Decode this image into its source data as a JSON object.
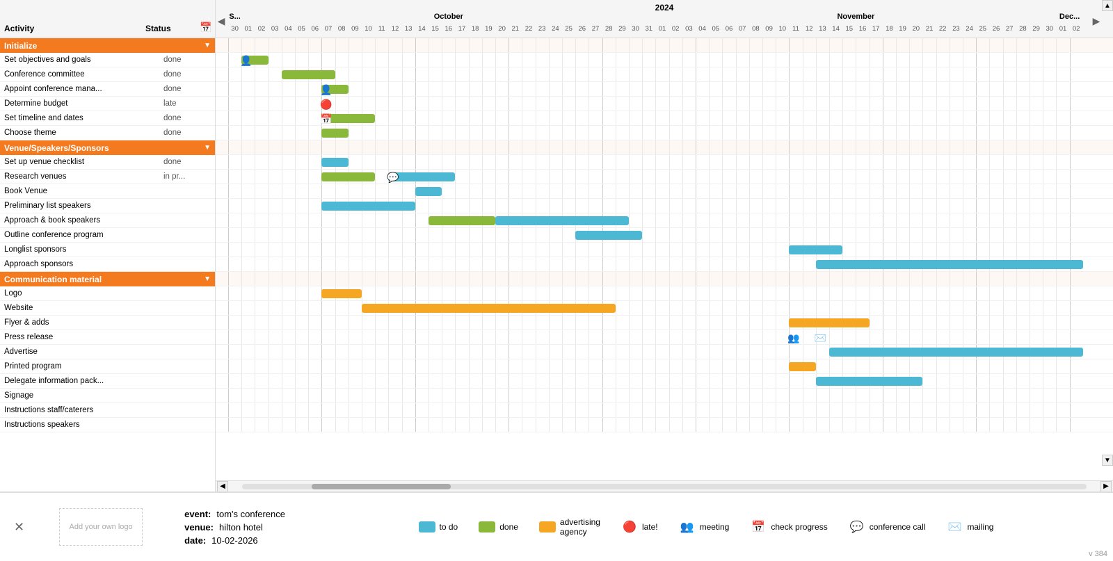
{
  "header": {
    "year": "2024",
    "months": [
      {
        "label": "October",
        "startCol": 5,
        "span": 27
      },
      {
        "label": "November",
        "startCol": 32,
        "span": 22
      },
      {
        "label": "Dec...",
        "startCol": 54,
        "span": 4
      }
    ]
  },
  "columns": {
    "activity": "Activity",
    "status": "Status"
  },
  "rows": [
    {
      "type": "group",
      "label": "Initialize"
    },
    {
      "type": "task",
      "name": "Set objectives and goals",
      "status": "done"
    },
    {
      "type": "task",
      "name": "Conference committee",
      "status": "done"
    },
    {
      "type": "task",
      "name": "Appoint conference mana...",
      "status": "done"
    },
    {
      "type": "task",
      "name": "Determine budget",
      "status": "late"
    },
    {
      "type": "task",
      "name": "Set timeline and dates",
      "status": "done"
    },
    {
      "type": "task",
      "name": "Choose theme",
      "status": "done"
    },
    {
      "type": "group",
      "label": "Venue/Speakers/Sponsors"
    },
    {
      "type": "task",
      "name": "Set up venue checklist",
      "status": "done"
    },
    {
      "type": "task",
      "name": "Research venues",
      "status": "in pr..."
    },
    {
      "type": "task",
      "name": "Book Venue",
      "status": ""
    },
    {
      "type": "task",
      "name": "Preliminary list speakers",
      "status": ""
    },
    {
      "type": "task",
      "name": "Approach & book speakers",
      "status": ""
    },
    {
      "type": "task",
      "name": "Outline conference program",
      "status": ""
    },
    {
      "type": "task",
      "name": "Longlist sponsors",
      "status": ""
    },
    {
      "type": "task",
      "name": "Approach sponsors",
      "status": ""
    },
    {
      "type": "group",
      "label": "Communication material"
    },
    {
      "type": "task",
      "name": "Logo",
      "status": ""
    },
    {
      "type": "task",
      "name": "Website",
      "status": ""
    },
    {
      "type": "task",
      "name": "Flyer & adds",
      "status": ""
    },
    {
      "type": "task",
      "name": "Press release",
      "status": ""
    },
    {
      "type": "task",
      "name": "Advertise",
      "status": ""
    },
    {
      "type": "task",
      "name": "Printed program",
      "status": ""
    },
    {
      "type": "task",
      "name": "Delegate information pack...",
      "status": ""
    },
    {
      "type": "task",
      "name": "Signage",
      "status": ""
    },
    {
      "type": "task",
      "name": "Instructions staff/caterers",
      "status": ""
    },
    {
      "type": "task",
      "name": "Instructions speakers",
      "status": ""
    }
  ],
  "footer": {
    "close_icon": "✕",
    "logo_placeholder": "Add your own logo",
    "event_label": "event:",
    "event_value": "tom's conference",
    "venue_label": "venue:",
    "venue_value": "hilton hotel",
    "date_label": "date:",
    "date_value": "10-02-2026",
    "legend": [
      {
        "type": "box",
        "color": "#4db8d4",
        "label": "to do"
      },
      {
        "type": "box",
        "color": "#8ab83a",
        "label": "done"
      },
      {
        "type": "box",
        "color": "#f5a623",
        "label": "advertising agency"
      },
      {
        "type": "icon",
        "icon": "🔴",
        "label": "late!"
      },
      {
        "type": "icon",
        "icon": "👥",
        "label": "meeting"
      },
      {
        "type": "icon",
        "icon": "📅",
        "label": "check progress"
      },
      {
        "type": "icon",
        "icon": "💬",
        "label": "conference call"
      },
      {
        "type": "icon",
        "icon": "✉️",
        "label": "mailing"
      }
    ],
    "version": "v 384"
  }
}
